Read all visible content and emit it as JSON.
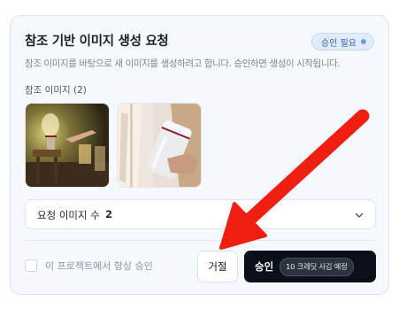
{
  "card": {
    "title": "참조 기반 이미지 생성 요청",
    "badge": "승인 필요",
    "subtitle": "참조 이미지를 바탕으로 새 이미지를 생성하려고 합니다. 승인하면 생성이 시작됩니다.",
    "references_label": "참조 이미지 (2)",
    "references": [
      {
        "icon": "reference-image-room-lamp"
      },
      {
        "icon": "reference-image-white-bottle"
      }
    ],
    "count_select": {
      "label": "요청 이미지 수",
      "value": "2",
      "icon": "chevron-down-icon"
    },
    "always_approve_label": "이 프로젝트에서 항상 승인",
    "always_approve_checked": false,
    "reject_button": "거절",
    "approve_button": "승인",
    "approve_cost": "10 크레딧 사김 예정"
  },
  "colors": {
    "card_bg": "#f5f9fd",
    "badge_bg": "#e0ecfb",
    "approve_bg": "#0b0f1a",
    "annotation_arrow": "#f01f12"
  }
}
